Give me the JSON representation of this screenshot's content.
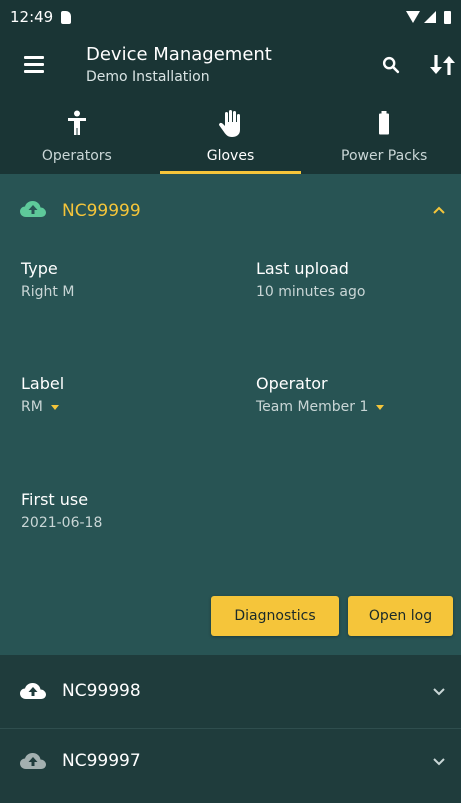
{
  "status_bar": {
    "time": "12:49"
  },
  "app_bar": {
    "title": "Device Management",
    "subtitle": "Demo Installation"
  },
  "tabs": [
    {
      "label": "Operators",
      "icon": "person-icon",
      "active": false
    },
    {
      "label": "Gloves",
      "icon": "hand-icon",
      "active": true
    },
    {
      "label": "Power Packs",
      "icon": "battery-icon",
      "active": false
    }
  ],
  "expanded_device": {
    "id": "NC99999",
    "fields": {
      "type_label": "Type",
      "type_value": "Right M",
      "last_upload_label": "Last upload",
      "last_upload_value": "10 minutes ago",
      "label_label": "Label",
      "label_value": "RM",
      "operator_label": "Operator",
      "operator_value": "Team Member 1",
      "first_use_label": "First use",
      "first_use_value": "2021-06-18"
    },
    "buttons": {
      "diagnostics": "Diagnostics",
      "open_log": "Open log"
    }
  },
  "collapsed_devices": [
    {
      "id": "NC99998"
    },
    {
      "id": "NC99997"
    }
  ],
  "colors": {
    "accent": "#f5c53a",
    "cloud_uploaded": "#5ec99a",
    "cloud_white": "#ffffff",
    "cloud_muted": "#a3b0b0",
    "expanded_card": "#285454",
    "header": "#1a3535"
  }
}
